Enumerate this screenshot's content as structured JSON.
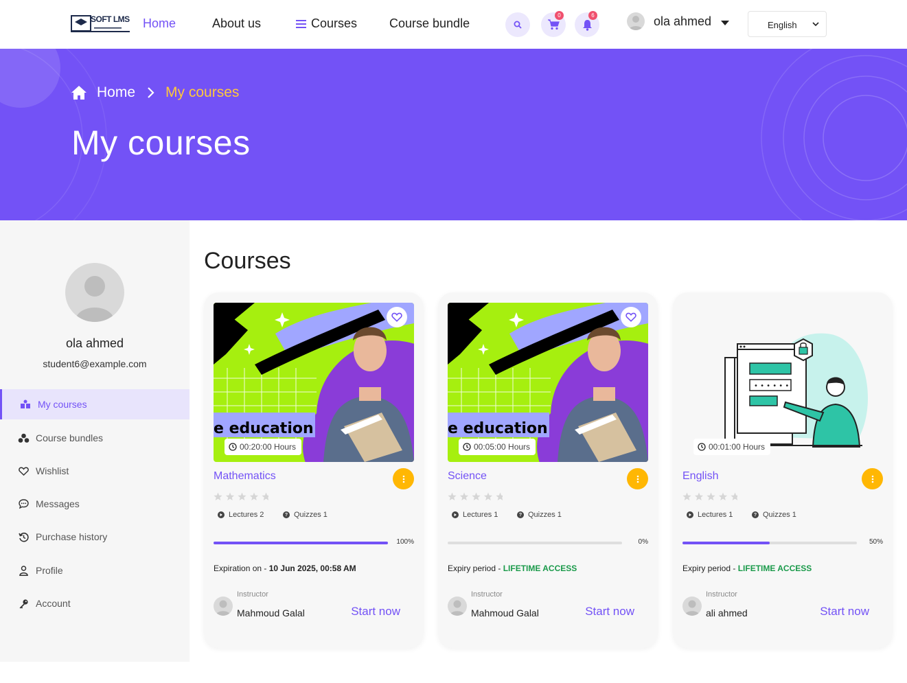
{
  "header": {
    "logo_text": "SOFT LMS",
    "nav": [
      {
        "label": "Home"
      },
      {
        "label": "About us"
      },
      {
        "label": "Courses"
      },
      {
        "label": "Course bundle"
      }
    ],
    "cart_count": "0",
    "notification_count": "6",
    "user_name": "ola ahmed",
    "language": "English"
  },
  "banner": {
    "breadcrumb_home": "Home",
    "breadcrumb_current": "My courses",
    "title": "My courses"
  },
  "sidebar": {
    "name": "ola ahmed",
    "email": "student6@example.com",
    "items": [
      {
        "label": "My courses",
        "icon": "courses-icon"
      },
      {
        "label": "Course bundles",
        "icon": "bundles-icon"
      },
      {
        "label": "Wishlist",
        "icon": "heart-icon"
      },
      {
        "label": "Messages",
        "icon": "chat-icon"
      },
      {
        "label": "Purchase history",
        "icon": "history-icon"
      },
      {
        "label": "Profile",
        "icon": "user-icon"
      },
      {
        "label": "Account",
        "icon": "key-icon"
      }
    ]
  },
  "main": {
    "title": "Courses",
    "cards": [
      {
        "thumb_text": "e education",
        "duration": "00:20:00 Hours",
        "name": "Mathematics",
        "lectures": "Lectures 2",
        "quizzes": "Quizzes 1",
        "progress": 1.0,
        "progress_label": "100%",
        "expiry_label": "Expiration on - ",
        "expiry_value": "10 Jun 2025, 00:58 AM",
        "instructor_label": "Instructor",
        "instructor": "Mahmoud Galal",
        "action": "Start now"
      },
      {
        "thumb_text": "e education",
        "duration": "00:05:00 Hours",
        "name": "Science",
        "lectures": "Lectures 1",
        "quizzes": "Quizzes 1",
        "progress": 0.0,
        "progress_label": "0%",
        "expiry_label": "Expiry period - ",
        "expiry_value": "LIFETIME ACCESS",
        "instructor_label": "Instructor",
        "instructor": "Mahmoud Galal",
        "action": "Start now"
      },
      {
        "thumb_text": "",
        "duration": "00:01:00 Hours",
        "name": "English",
        "lectures": "Lectures 1",
        "quizzes": "Quizzes 1",
        "progress": 0.5,
        "progress_label": "50%",
        "expiry_label": "Expiry period - ",
        "expiry_value": "LIFETIME ACCESS",
        "instructor_label": "Instructor",
        "instructor": "ali ahmed",
        "action": "Start now"
      }
    ]
  },
  "colors": {
    "accent": "#7352f6",
    "highlight": "#ffc83d",
    "menu_button": "#ffb703",
    "lifetime": "#1a9a4a"
  }
}
